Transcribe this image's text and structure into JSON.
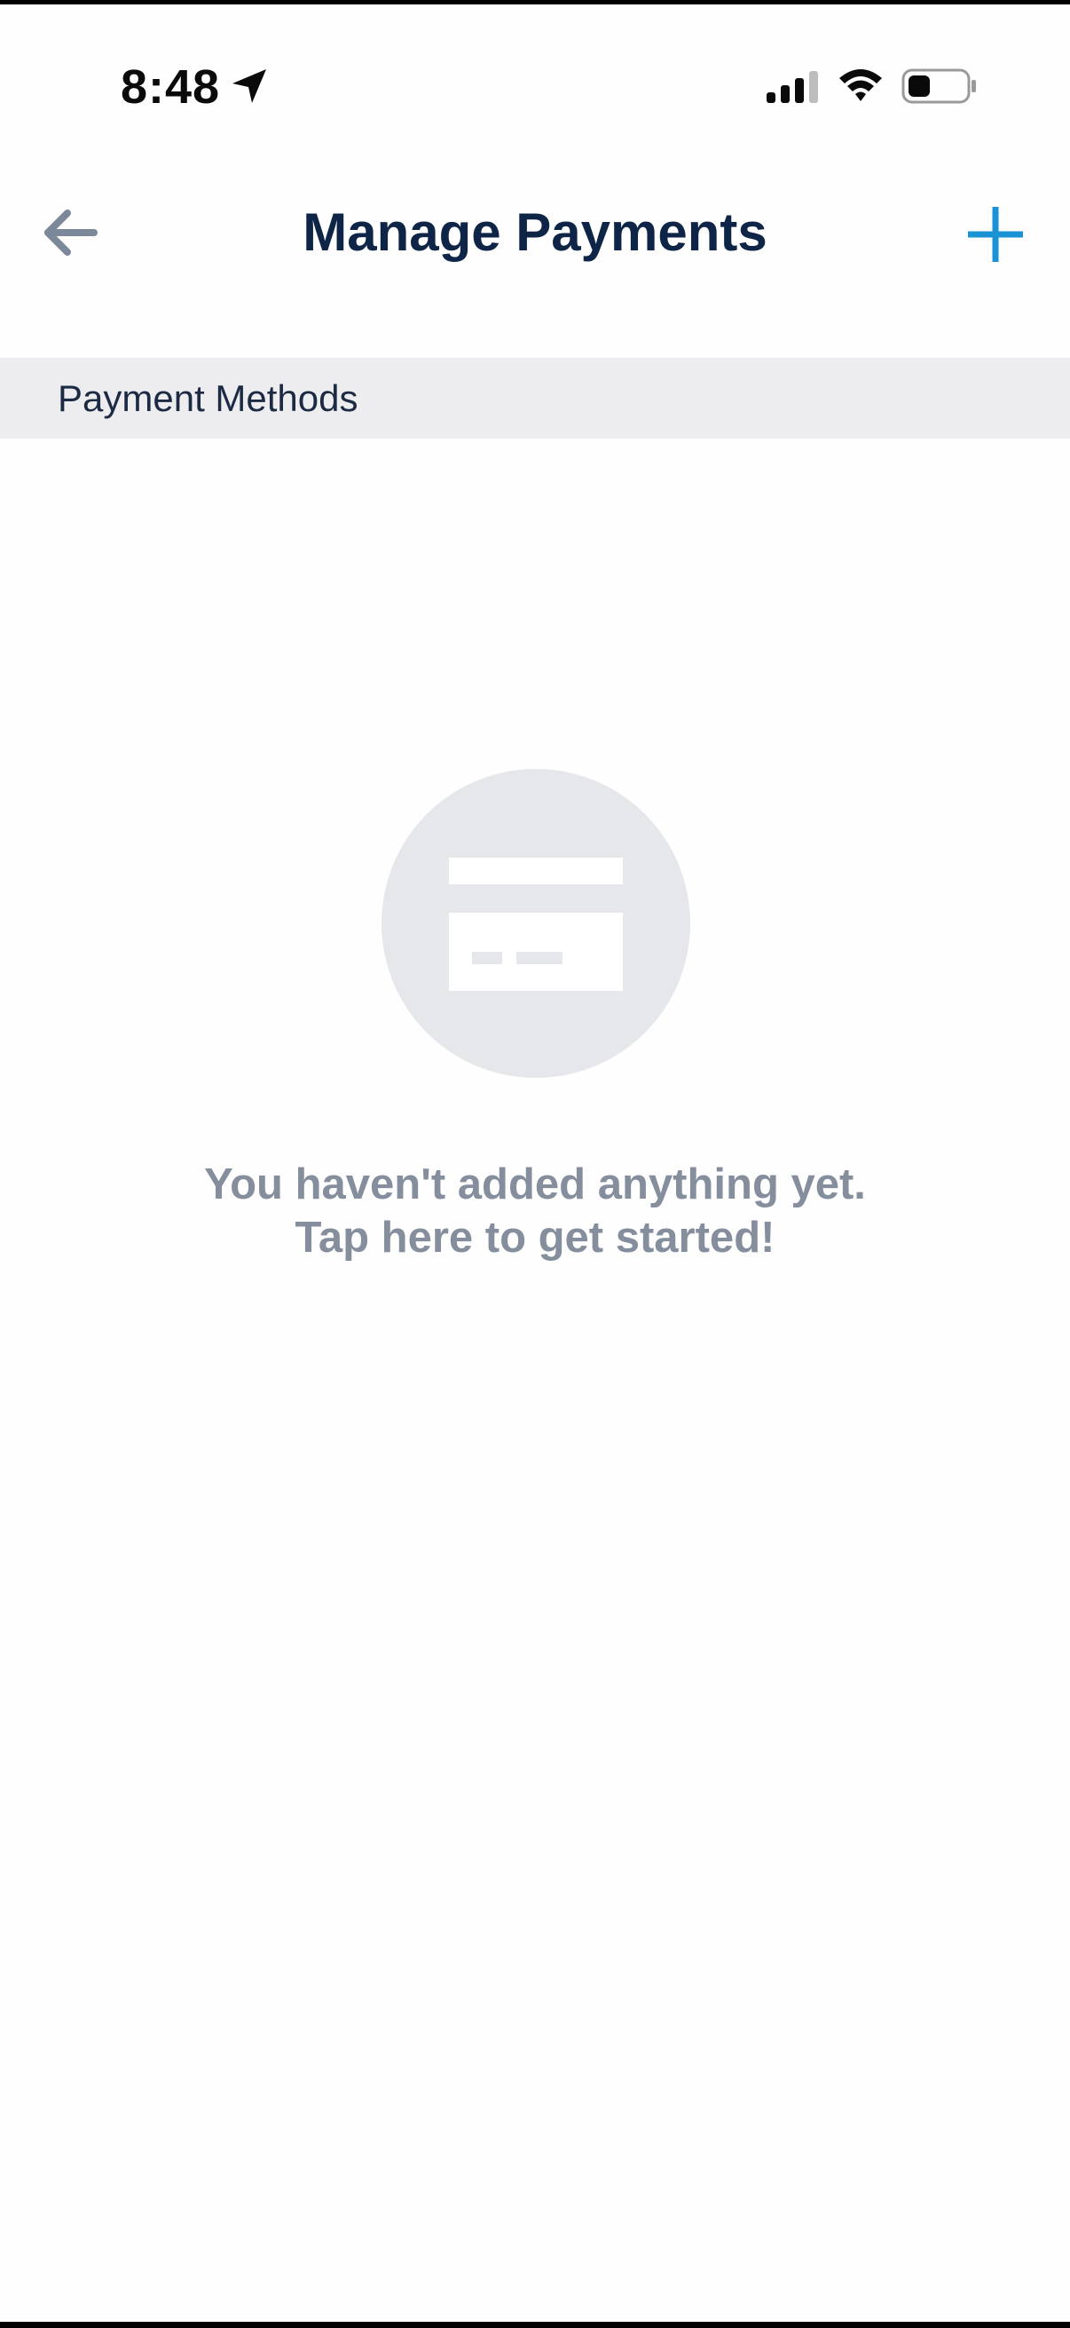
{
  "status_bar": {
    "time": "8:48",
    "icons": [
      "location-arrow-icon",
      "cellular-signal-icon",
      "wifi-icon",
      "battery-icon"
    ]
  },
  "header": {
    "title": "Manage Payments",
    "back_icon": "back-arrow-icon",
    "add_icon": "plus-icon"
  },
  "section": {
    "title": "Payment Methods"
  },
  "empty_state": {
    "icon": "credit-card-icon",
    "line1": "You haven't added anything yet.",
    "line2": "Tap here to get started!"
  },
  "colors": {
    "title_navy": "#0f2547",
    "accent_blue": "#1a93d6",
    "muted_gray": "#858e9d",
    "section_bg": "#ededf0",
    "back_arrow": "#7b889a"
  }
}
